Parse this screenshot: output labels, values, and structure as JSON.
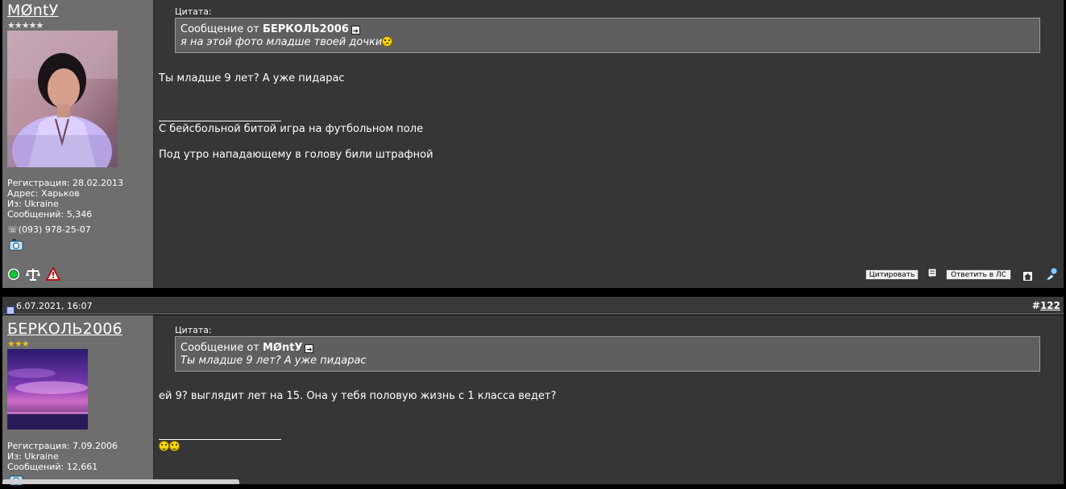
{
  "post1": {
    "username": "MØntУ",
    "stars": "★★★★★",
    "info": {
      "registration": "Регистрация: 28.02.2013",
      "address": "Адрес: Харьков",
      "from": "Из: Ukraine",
      "posts": "Сообщений: 5,346",
      "phone": "☏(093) 978-25-07"
    },
    "quote": {
      "label": "Цитата:",
      "from_prefix": "Сообщение от ",
      "author": "БЕРКОЛЬ2006",
      "text": "я на этой фото младше твоей дочки"
    },
    "message": "Ты младше 9 лет? А уже пидарас",
    "signature": [
      "С бейсбольной битой игра на футбольном поле",
      "Под утро нападающему в голову били штрафной"
    ],
    "buttons": {
      "quote": "Цитировать",
      "reply_pm": "Ответить в ЛС"
    }
  },
  "post2": {
    "date": "6.07.2021, 16:07",
    "hash": "#",
    "number": "122",
    "username": "БЕРКОЛЬ2006",
    "stars": "★★★",
    "info": {
      "registration": "Регистрация: 7.09.2006",
      "from": "Из: Ukraine",
      "posts": "Сообщений: 12,661"
    },
    "quote": {
      "label": "Цитата:",
      "from_prefix": "Сообщение от ",
      "author": "MØntУ",
      "text": "Ты младше 9 лет? А уже пидарас"
    },
    "message": "ей 9? выглядит лет на 15. Она у тебя половую жизнь с 1 класса ведет?"
  },
  "colors": {
    "sidebar_bg": "#6e6e6e",
    "content_bg": "#363636",
    "quote_bg": "#5f5f5f",
    "smiley": "#ffd800"
  }
}
